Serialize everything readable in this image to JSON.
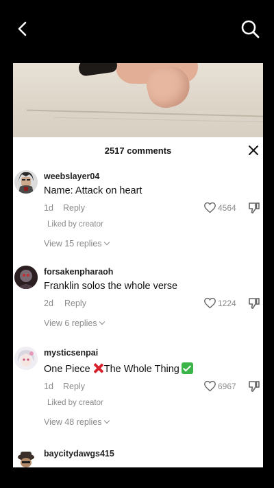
{
  "top_bar": {
    "back_icon": "chevron-left-icon",
    "search_icon": "search-icon"
  },
  "comments_sheet": {
    "count_label": "2517 comments",
    "close_icon": "close-icon",
    "comments": [
      {
        "username": "weebslayer04",
        "text": "Name: Attack on heart",
        "age": "1d",
        "reply_label": "Reply",
        "likes": "4564",
        "liked_by_creator": "Liked by creator",
        "view_replies": "View 15 replies"
      },
      {
        "username": "forsakenpharaoh",
        "text": "Franklin solos the whole verse",
        "age": "2d",
        "reply_label": "Reply",
        "likes": "1224",
        "view_replies": "View 6 replies"
      },
      {
        "username": "mysticsenpai",
        "text_part1": "One Piece",
        "text_part2": "The Whole Thing",
        "age": "1d",
        "reply_label": "Reply",
        "likes": "6967",
        "liked_by_creator": "Liked by creator",
        "view_replies": "View 48 replies"
      },
      {
        "username": "baycitydawgs415"
      }
    ]
  },
  "colors": {
    "secondary_text": "#8a8a8a",
    "sheet_bg": "#ffffff",
    "page_bg": "#000000"
  }
}
